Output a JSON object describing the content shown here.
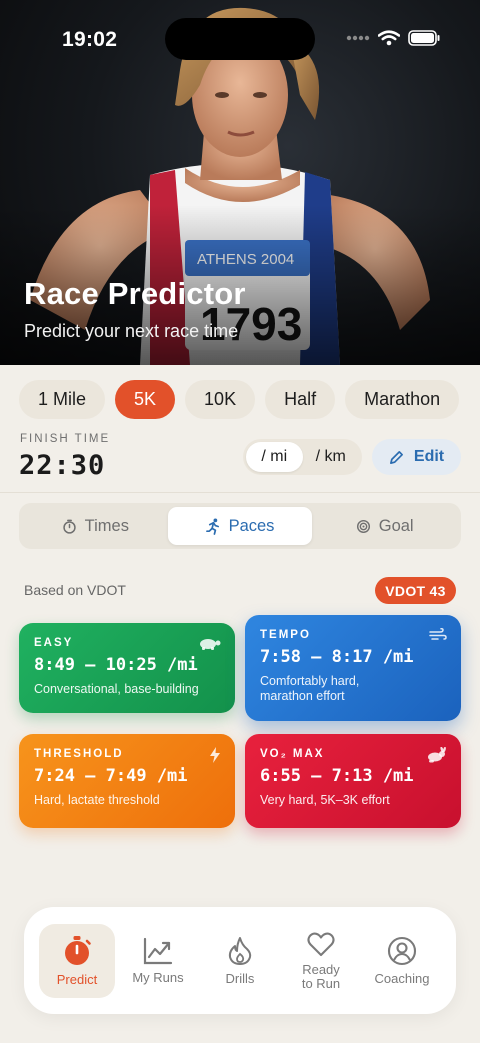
{
  "status": {
    "time": "19:02"
  },
  "hero": {
    "title": "Race Predictor",
    "subtitle": "Predict your next race time"
  },
  "distances": [
    "1 Mile",
    "5K",
    "10K",
    "Half",
    "Marathon"
  ],
  "selected_distance": "5K",
  "finish": {
    "label": "FINISH TIME",
    "value": "22:30"
  },
  "units": {
    "options": [
      "/ mi",
      "/ km"
    ],
    "selected": "/ mi"
  },
  "edit_label": "Edit",
  "tabs": {
    "times": "Times",
    "paces": "Paces",
    "goal": "Goal",
    "selected": "Paces"
  },
  "vdot": {
    "caption": "Based on VDOT",
    "badge": "VDOT 43"
  },
  "paces": {
    "easy": {
      "label": "EASY",
      "range": "8:49 – 10:25 /mi",
      "desc": "Conversational, base-building",
      "color": "#1aa356"
    },
    "tempo": {
      "label": "TEMPO",
      "range": "7:58 – 8:17 /mi",
      "desc": "Comfortably hard,\nmarathon effort",
      "color": "#2676d2"
    },
    "threshold": {
      "label": "THRESHOLD",
      "range": "7:24 – 7:49 /mi",
      "desc": "Hard, lactate threshold",
      "color": "#f48015"
    },
    "vo2max": {
      "label": "VO₂ MAX",
      "range": "6:55 – 7:13 /mi",
      "desc": "Very hard, 5K–3K effort",
      "color": "#d91535"
    }
  },
  "nav": {
    "predict": "Predict",
    "my_runs": "My Runs",
    "drills": "Drills",
    "ready_to_run": "Ready\nto Run",
    "coaching": "Coaching",
    "active": "Predict"
  },
  "accent": "#e2512a",
  "link_color": "#2b6cb0"
}
